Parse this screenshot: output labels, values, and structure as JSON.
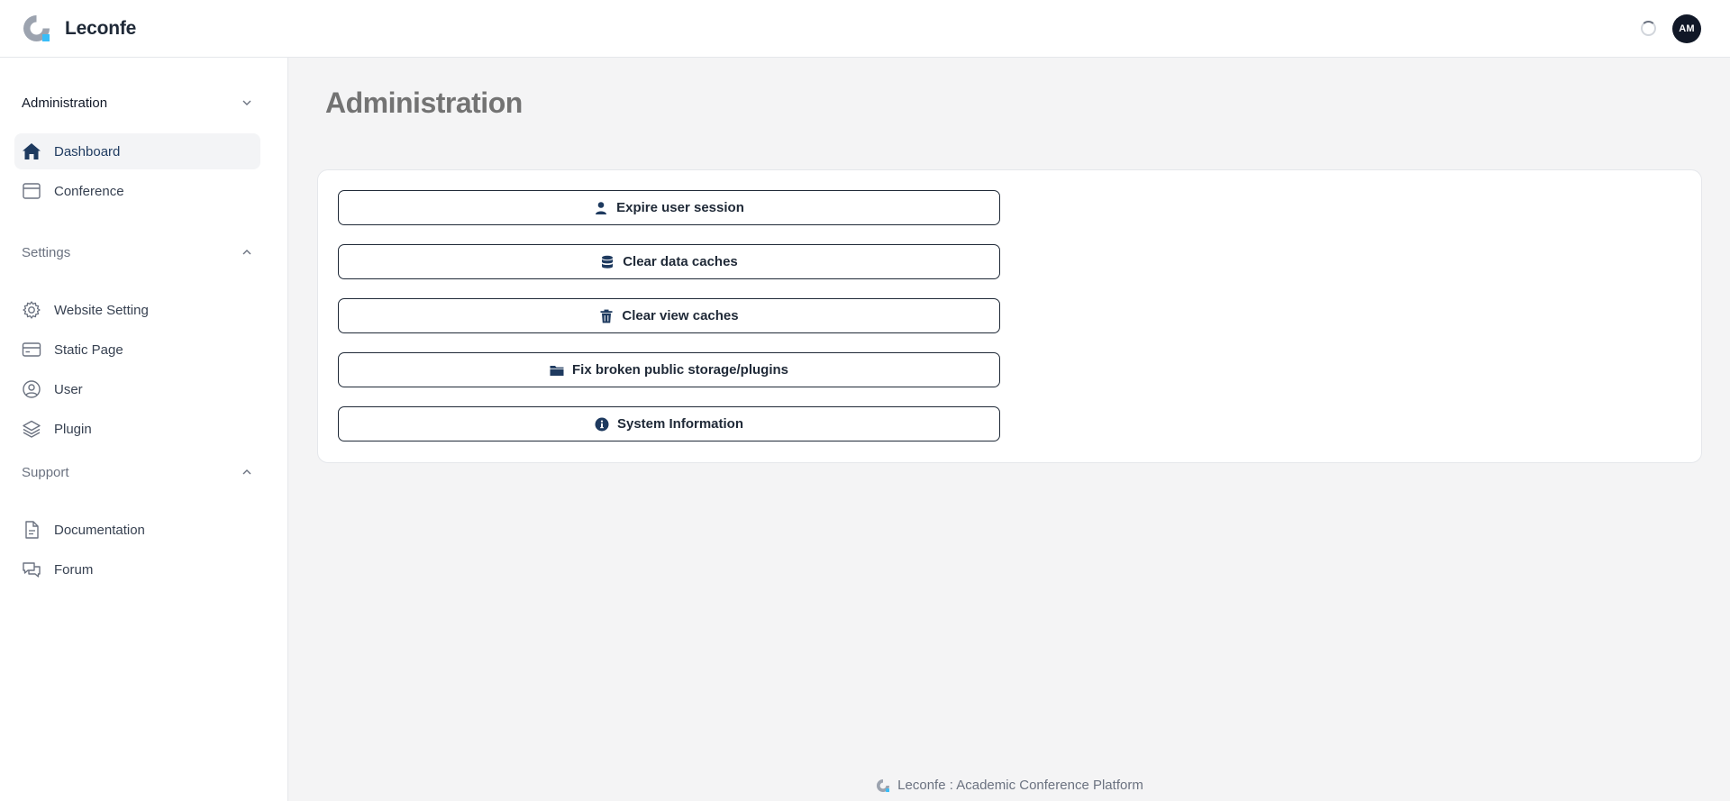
{
  "app": {
    "name": "Leconfe"
  },
  "user": {
    "initials": "AM"
  },
  "sidebar": {
    "administration": {
      "label": "Administration",
      "items": [
        {
          "label": "Dashboard",
          "icon": "home-icon",
          "active": true
        },
        {
          "label": "Conference",
          "icon": "window-icon"
        }
      ]
    },
    "settings": {
      "label": "Settings",
      "items": [
        {
          "label": "Website Setting",
          "icon": "gear-icon"
        },
        {
          "label": "Static Page",
          "icon": "card-icon"
        },
        {
          "label": "User",
          "icon": "user-circle-icon"
        },
        {
          "label": "Plugin",
          "icon": "layers-icon"
        }
      ]
    },
    "support": {
      "label": "Support",
      "items": [
        {
          "label": "Documentation",
          "icon": "document-icon"
        },
        {
          "label": "Forum",
          "icon": "chat-bubbles-icon"
        }
      ]
    }
  },
  "main": {
    "title": "Administration",
    "actions": [
      {
        "label": "Expire user session",
        "icon": "user-icon"
      },
      {
        "label": "Clear data caches",
        "icon": "database-icon"
      },
      {
        "label": "Clear view caches",
        "icon": "trash-icon"
      },
      {
        "label": "Fix broken public storage/plugins",
        "icon": "folder-icon"
      },
      {
        "label": "System Information",
        "icon": "info-icon"
      }
    ]
  },
  "footer": {
    "text": "Leconfe : Academic Conference Platform"
  },
  "colors": {
    "accent": "#38bdf8",
    "navy": "#1e3a5f",
    "logo_gray": "#9ca3af"
  }
}
